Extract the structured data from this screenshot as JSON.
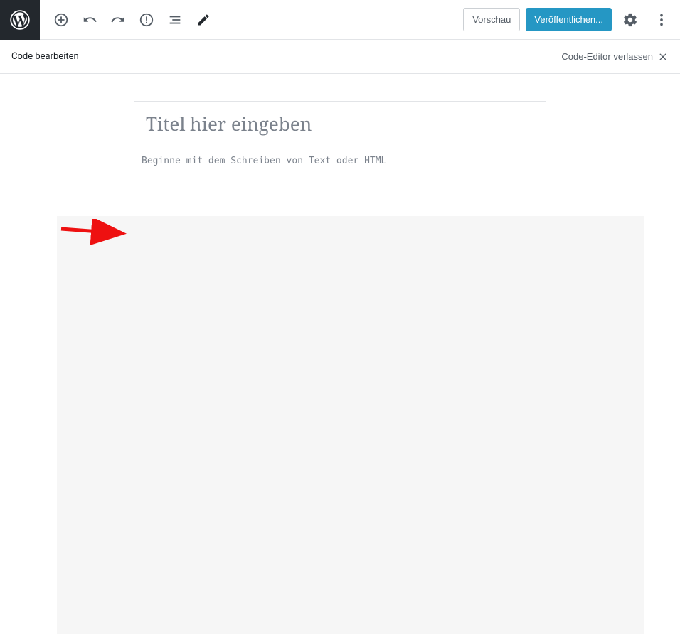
{
  "toolbar": {
    "preview_label": "Vorschau",
    "publish_label": "Veröffentlichen..."
  },
  "subbar": {
    "title": "Code bearbeiten",
    "exit_label": "Code-Editor verlassen"
  },
  "editor": {
    "title_placeholder": "Titel hier eingeben",
    "content_placeholder": "Beginne mit dem Schreiben von Text oder HTML"
  }
}
